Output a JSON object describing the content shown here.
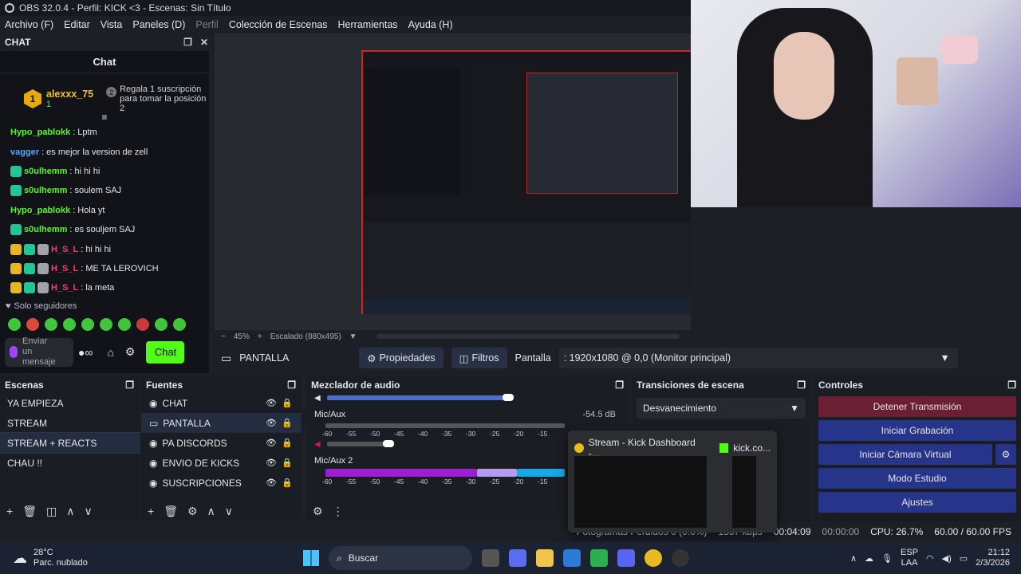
{
  "title_bar": {
    "text": "OBS 32.0.4 - Perfil: KICK <3 - Escenas: Sin Título"
  },
  "menu": [
    "Archivo (F)",
    "Editar",
    "Vista",
    "Paneles (D)",
    "Perfil",
    "Colección de Escenas",
    "Herramientas",
    "Ayuda (H)"
  ],
  "chat_dock": {
    "title": "CHAT"
  },
  "chat": {
    "header": "Chat",
    "gift": {
      "user": "alexxx_75",
      "count": "1",
      "rank": "1",
      "rank2": "2",
      "text": "Regala 1 suscripción para tomar la posición 2"
    },
    "messages": [
      {
        "user": "Hypo_pablokk",
        "text": "Lptm",
        "color": "#53fc18"
      },
      {
        "user": "vagger",
        "text": "es mejor la version de zell",
        "color": "#56a6ff"
      },
      {
        "user": "s0ulhemm",
        "text": "hi hi hi",
        "color": "#53fc18"
      },
      {
        "user": "s0ulhemm",
        "text": "soulem SAJ",
        "color": "#53fc18"
      },
      {
        "user": "Hypo_pablokk",
        "text": "Hola yt",
        "color": "#53fc18"
      },
      {
        "user": "s0ulhemm",
        "text": "es souljem SAJ",
        "color": "#53fc18"
      },
      {
        "user": "H_S_L",
        "text": "hi hi hi",
        "color": "#ff3b6b"
      },
      {
        "user": "H_S_L",
        "text": "ME TA LEROVICH",
        "color": "#ff3b6b"
      },
      {
        "user": "H_S_L",
        "text": "la meta",
        "color": "#ff3b6b"
      }
    ],
    "followers_only": "Solo seguidores",
    "input_placeholder": "Enviar un mensaje",
    "send_label": "Chat"
  },
  "zoom": {
    "level": "45%",
    "scale": "Escalado (880x495)"
  },
  "context": {
    "source": "PANTALLA",
    "properties": "Propiedades",
    "filters": "Filtros",
    "display_label": "Pantalla",
    "display_value": ": 1920x1080 @ 0,0 (Monitor principal)"
  },
  "scenes": {
    "title": "Escenas",
    "items": [
      "YA EMPIEZA",
      "STREAM",
      "STREAM + REACTS",
      "CHAU !!"
    ],
    "selected": 2
  },
  "sources": {
    "title": "Fuentes",
    "items": [
      "CHAT",
      "PANTALLA",
      "PA DISCORDS",
      "ENVIO DE KICKS",
      "SUSCRIPCIONES"
    ],
    "selected": 1
  },
  "mixer": {
    "title": "Mezclador de audio",
    "channels": [
      {
        "name": "Mic/Aux",
        "db": "-54.5 dB"
      },
      {
        "name": "Mic/Aux 2",
        "db": ""
      }
    ],
    "ticks": [
      "-60",
      "-55",
      "-50",
      "-45",
      "-40",
      "-35",
      "-30",
      "-25",
      "-20",
      "-15"
    ]
  },
  "transitions": {
    "title": "Transiciones de escena",
    "value": "Desvanecimiento"
  },
  "controls": {
    "title": "Controles",
    "buttons": [
      "Detener Transmisión",
      "Iniciar Grabación",
      "Iniciar Cámara Virtual",
      "Modo Estudio",
      "Ajustes"
    ]
  },
  "popup": {
    "tab1": "Stream - Kick Dashboard -...",
    "tab2": "kick.co..."
  },
  "status": {
    "dropped": "Fotogramas Perdidos 0 (0.0%)",
    "bitrate": "1567 kbps",
    "stream_time": "00:04:09",
    "rec_time": "00:00:00",
    "cpu": "CPU: 26.7%",
    "fps": "60.00 / 60.00 FPS"
  },
  "taskbar": {
    "temp": "28°C",
    "weather": "Parc. nublado",
    "search": "Buscar",
    "lang1": "ESP",
    "lang2": "LAA",
    "time": "21:12",
    "date": "2/3/2026"
  },
  "colors": {
    "accent_green": "#53fc18",
    "stream_stop": "#6b1f33",
    "blue_button": "#26358a",
    "selected": "#242c40"
  }
}
